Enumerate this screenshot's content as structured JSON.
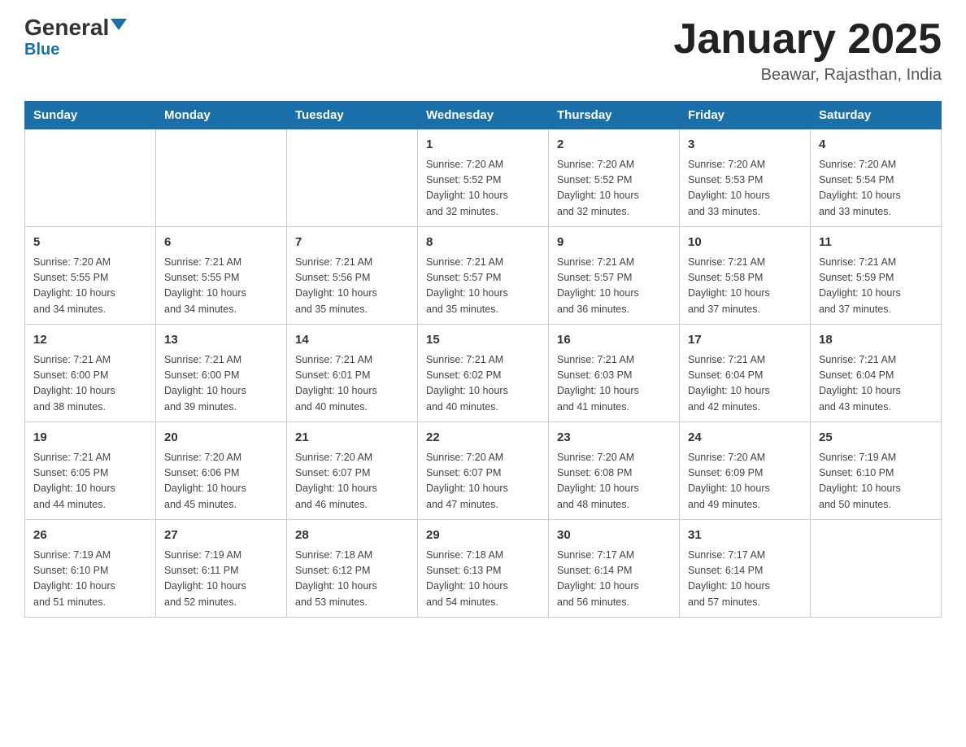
{
  "header": {
    "logo_general": "General",
    "logo_blue": "Blue",
    "title": "January 2025",
    "subtitle": "Beawar, Rajasthan, India"
  },
  "weekdays": [
    "Sunday",
    "Monday",
    "Tuesday",
    "Wednesday",
    "Thursday",
    "Friday",
    "Saturday"
  ],
  "weeks": [
    [
      {
        "day": "",
        "info": ""
      },
      {
        "day": "",
        "info": ""
      },
      {
        "day": "",
        "info": ""
      },
      {
        "day": "1",
        "info": "Sunrise: 7:20 AM\nSunset: 5:52 PM\nDaylight: 10 hours\nand 32 minutes."
      },
      {
        "day": "2",
        "info": "Sunrise: 7:20 AM\nSunset: 5:52 PM\nDaylight: 10 hours\nand 32 minutes."
      },
      {
        "day": "3",
        "info": "Sunrise: 7:20 AM\nSunset: 5:53 PM\nDaylight: 10 hours\nand 33 minutes."
      },
      {
        "day": "4",
        "info": "Sunrise: 7:20 AM\nSunset: 5:54 PM\nDaylight: 10 hours\nand 33 minutes."
      }
    ],
    [
      {
        "day": "5",
        "info": "Sunrise: 7:20 AM\nSunset: 5:55 PM\nDaylight: 10 hours\nand 34 minutes."
      },
      {
        "day": "6",
        "info": "Sunrise: 7:21 AM\nSunset: 5:55 PM\nDaylight: 10 hours\nand 34 minutes."
      },
      {
        "day": "7",
        "info": "Sunrise: 7:21 AM\nSunset: 5:56 PM\nDaylight: 10 hours\nand 35 minutes."
      },
      {
        "day": "8",
        "info": "Sunrise: 7:21 AM\nSunset: 5:57 PM\nDaylight: 10 hours\nand 35 minutes."
      },
      {
        "day": "9",
        "info": "Sunrise: 7:21 AM\nSunset: 5:57 PM\nDaylight: 10 hours\nand 36 minutes."
      },
      {
        "day": "10",
        "info": "Sunrise: 7:21 AM\nSunset: 5:58 PM\nDaylight: 10 hours\nand 37 minutes."
      },
      {
        "day": "11",
        "info": "Sunrise: 7:21 AM\nSunset: 5:59 PM\nDaylight: 10 hours\nand 37 minutes."
      }
    ],
    [
      {
        "day": "12",
        "info": "Sunrise: 7:21 AM\nSunset: 6:00 PM\nDaylight: 10 hours\nand 38 minutes."
      },
      {
        "day": "13",
        "info": "Sunrise: 7:21 AM\nSunset: 6:00 PM\nDaylight: 10 hours\nand 39 minutes."
      },
      {
        "day": "14",
        "info": "Sunrise: 7:21 AM\nSunset: 6:01 PM\nDaylight: 10 hours\nand 40 minutes."
      },
      {
        "day": "15",
        "info": "Sunrise: 7:21 AM\nSunset: 6:02 PM\nDaylight: 10 hours\nand 40 minutes."
      },
      {
        "day": "16",
        "info": "Sunrise: 7:21 AM\nSunset: 6:03 PM\nDaylight: 10 hours\nand 41 minutes."
      },
      {
        "day": "17",
        "info": "Sunrise: 7:21 AM\nSunset: 6:04 PM\nDaylight: 10 hours\nand 42 minutes."
      },
      {
        "day": "18",
        "info": "Sunrise: 7:21 AM\nSunset: 6:04 PM\nDaylight: 10 hours\nand 43 minutes."
      }
    ],
    [
      {
        "day": "19",
        "info": "Sunrise: 7:21 AM\nSunset: 6:05 PM\nDaylight: 10 hours\nand 44 minutes."
      },
      {
        "day": "20",
        "info": "Sunrise: 7:20 AM\nSunset: 6:06 PM\nDaylight: 10 hours\nand 45 minutes."
      },
      {
        "day": "21",
        "info": "Sunrise: 7:20 AM\nSunset: 6:07 PM\nDaylight: 10 hours\nand 46 minutes."
      },
      {
        "day": "22",
        "info": "Sunrise: 7:20 AM\nSunset: 6:07 PM\nDaylight: 10 hours\nand 47 minutes."
      },
      {
        "day": "23",
        "info": "Sunrise: 7:20 AM\nSunset: 6:08 PM\nDaylight: 10 hours\nand 48 minutes."
      },
      {
        "day": "24",
        "info": "Sunrise: 7:20 AM\nSunset: 6:09 PM\nDaylight: 10 hours\nand 49 minutes."
      },
      {
        "day": "25",
        "info": "Sunrise: 7:19 AM\nSunset: 6:10 PM\nDaylight: 10 hours\nand 50 minutes."
      }
    ],
    [
      {
        "day": "26",
        "info": "Sunrise: 7:19 AM\nSunset: 6:10 PM\nDaylight: 10 hours\nand 51 minutes."
      },
      {
        "day": "27",
        "info": "Sunrise: 7:19 AM\nSunset: 6:11 PM\nDaylight: 10 hours\nand 52 minutes."
      },
      {
        "day": "28",
        "info": "Sunrise: 7:18 AM\nSunset: 6:12 PM\nDaylight: 10 hours\nand 53 minutes."
      },
      {
        "day": "29",
        "info": "Sunrise: 7:18 AM\nSunset: 6:13 PM\nDaylight: 10 hours\nand 54 minutes."
      },
      {
        "day": "30",
        "info": "Sunrise: 7:17 AM\nSunset: 6:14 PM\nDaylight: 10 hours\nand 56 minutes."
      },
      {
        "day": "31",
        "info": "Sunrise: 7:17 AM\nSunset: 6:14 PM\nDaylight: 10 hours\nand 57 minutes."
      },
      {
        "day": "",
        "info": ""
      }
    ]
  ]
}
